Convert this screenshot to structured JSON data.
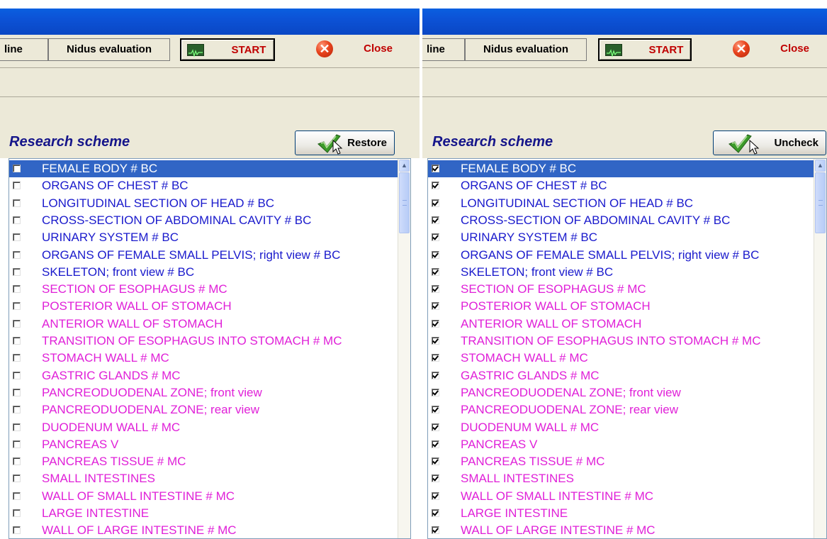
{
  "panels": [
    {
      "toolbar": {
        "online_label": "line",
        "nidus_label": "Nidus evaluation",
        "start_label": "START",
        "close_label": "Close"
      },
      "scheme": {
        "title": "Research scheme",
        "button_label": "Restore"
      },
      "items_checked": false
    },
    {
      "toolbar": {
        "online_label": "line",
        "nidus_label": "Nidus evaluation",
        "start_label": "START",
        "close_label": "Close"
      },
      "scheme": {
        "title": "Research scheme",
        "button_label": "Uncheck"
      },
      "items_checked": true
    }
  ],
  "list_items": [
    {
      "label": "FEMALE BODY # BC",
      "color": "#1a1acc",
      "selected": true
    },
    {
      "label": "ORGANS OF CHEST # BC",
      "color": "#1a1acc"
    },
    {
      "label": "LONGITUDINAL SECTION OF HEAD # BC",
      "color": "#1a1acc"
    },
    {
      "label": "CROSS-SECTION OF ABDOMINAL CAVITY # BC",
      "color": "#1a1acc"
    },
    {
      "label": "URINARY SYSTEM # BC",
      "color": "#1a1acc"
    },
    {
      "label": "ORGANS OF FEMALE SMALL PELVIS; right view # BC",
      "color": "#1a1acc"
    },
    {
      "label": "SKELETON; front view # BC",
      "color": "#1a1acc"
    },
    {
      "label": "SECTION OF ESOPHAGUS # MC",
      "color": "#e020d8"
    },
    {
      "label": "POSTERIOR WALL OF STOMACH",
      "color": "#e020d8"
    },
    {
      "label": "ANTERIOR WALL OF STOMACH",
      "color": "#e020d8"
    },
    {
      "label": "TRANSITION OF ESOPHAGUS INTO STOMACH # MC",
      "color": "#e020d8"
    },
    {
      "label": "STOMACH WALL # MC",
      "color": "#e020d8"
    },
    {
      "label": "GASTRIC GLANDS # MC",
      "color": "#e020d8"
    },
    {
      "label": "PANCREODUODENAL ZONE; front view",
      "color": "#e020d8"
    },
    {
      "label": "PANCREODUODENAL ZONE; rear view",
      "color": "#e020d8"
    },
    {
      "label": "DUODENUM WALL # MC",
      "color": "#e020d8"
    },
    {
      "label": "PANCREAS V",
      "color": "#e020d8"
    },
    {
      "label": "PANCREAS TISSUE # MC",
      "color": "#e020d8"
    },
    {
      "label": "SMALL INTESTINES",
      "color": "#e020d8"
    },
    {
      "label": "WALL OF SMALL INTESTINE # MC",
      "color": "#e020d8"
    },
    {
      "label": "LARGE INTESTINE",
      "color": "#e020d8"
    },
    {
      "label": "WALL OF LARGE INTESTINE # MC",
      "color": "#e020d8"
    }
  ],
  "icons": {
    "start": "monitor-icon",
    "close": "close-icon",
    "scheme_button": "checkmark-icon",
    "cursor": "mouse-cursor-icon"
  }
}
